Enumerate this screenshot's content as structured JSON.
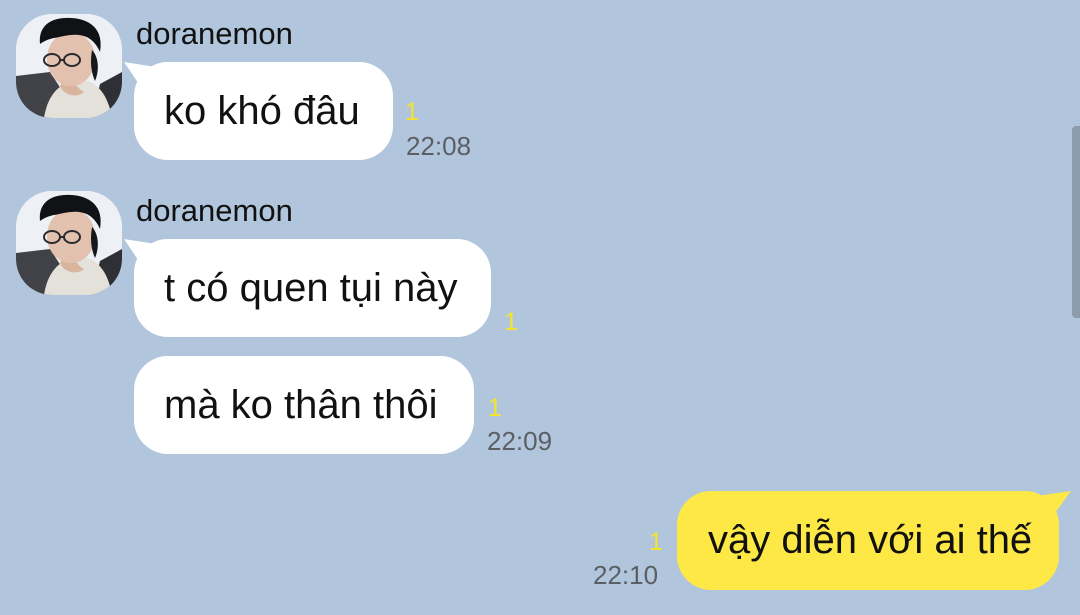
{
  "messages": [
    {
      "sender": "doranemon",
      "text": "ko khó đâu",
      "unread": "1",
      "time": "22:08"
    },
    {
      "sender": "doranemon",
      "text": "t có quen tụi này",
      "unread": "1"
    },
    {
      "text": "mà ko thân thôi",
      "unread": "1",
      "time": "22:09"
    },
    {
      "text": "vậy diễn với ai thế",
      "unread": "1",
      "time": "22:10"
    }
  ],
  "colors": {
    "chat_background": "#b1c6dc",
    "received_bubble": "#ffffff",
    "sent_bubble": "#fde846",
    "unread_marker": "#f4e52c",
    "timestamp": "#5b5f64"
  }
}
